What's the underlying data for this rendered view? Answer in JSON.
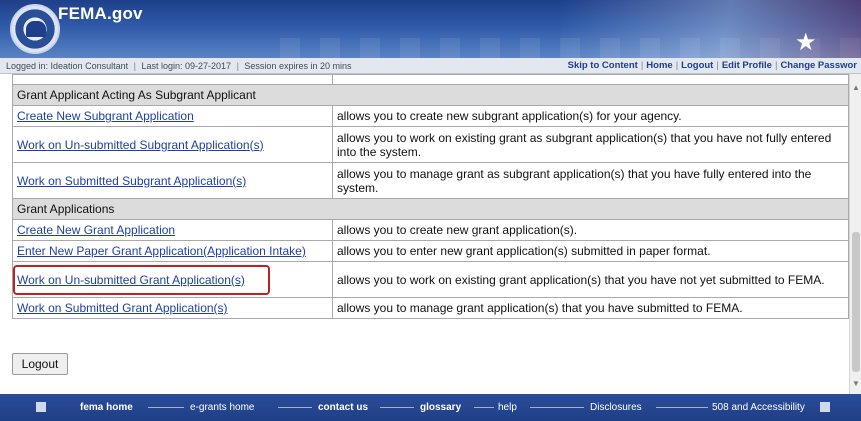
{
  "header": {
    "site_title": "FEMA.gov"
  },
  "status": {
    "logged_in_as": "Logged in: Ideation Consultant",
    "last_login": "Last login: 09-27-2017",
    "session": "Session expires in 20 mins",
    "sep": "|",
    "links": {
      "skip": "Skip to Content",
      "home": "Home",
      "logout": "Logout",
      "edit_profile": "Edit Profile",
      "change_password": "Change Passwor"
    }
  },
  "sections": [
    {
      "title": "Grant Applicant Acting As Subgrant Applicant",
      "rows": [
        {
          "link": "Create New Subgrant Application",
          "desc": "allows you to create new subgrant application(s) for your agency."
        },
        {
          "link": "Work on Un-submitted Subgrant Application(s)",
          "desc": "allows you to work on existing grant as subgrant application(s) that you have not fully entered into the system."
        },
        {
          "link": "Work on Submitted Subgrant Application(s)",
          "desc": "allows you to manage grant as subgrant application(s) that you have fully entered into the system."
        }
      ]
    },
    {
      "title": "Grant Applications",
      "rows": [
        {
          "link": "Create New Grant Application",
          "desc": "allows you to create new grant application(s)."
        },
        {
          "link": "Enter New Paper Grant Application(Application Intake)",
          "desc": "allows you to enter new grant application(s) submitted in paper format."
        },
        {
          "link": "Work on Un-submitted Grant Application(s)",
          "desc": "allows you to work on existing grant application(s) that you have not yet submitted to FEMA."
        },
        {
          "link": "Work on Submitted Grant Application(s)",
          "desc": "allows you to manage grant application(s) that you have submitted to FEMA."
        }
      ]
    }
  ],
  "buttons": {
    "logout": "Logout"
  },
  "footer": {
    "fema_home": "fema home",
    "egrants_home": "e-grants home",
    "contact_us": "contact us",
    "glossary": "glossary",
    "help": "help",
    "disclosures": "Disclosures",
    "accessibility": "508 and Accessibility"
  },
  "colors": {
    "link": "#1f3fa6",
    "header_blue": "#1f3f8a",
    "section_bg": "#dcdcdc",
    "highlight": "#c0201f"
  }
}
